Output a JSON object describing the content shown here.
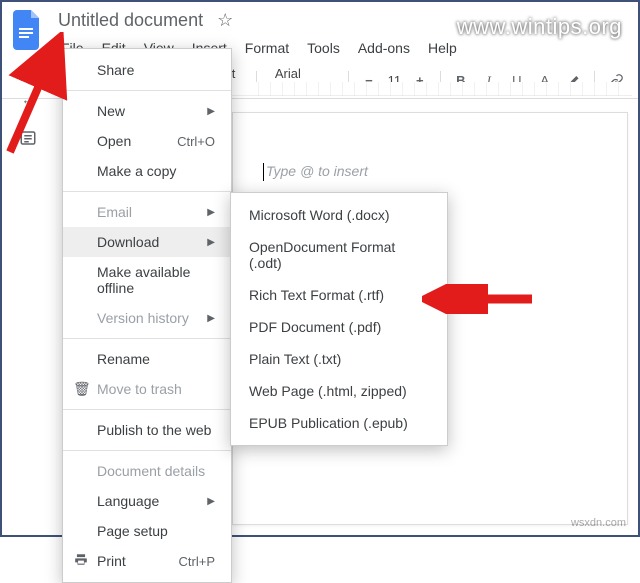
{
  "doc": {
    "title": "Untitled document"
  },
  "menubar": {
    "file": "File",
    "edit": "Edit",
    "view": "View",
    "insert": "Insert",
    "format": "Format",
    "tools": "Tools",
    "addons": "Add-ons",
    "help": "Help"
  },
  "toolbar": {
    "style_label": "ormal text",
    "font_label": "Arial",
    "font_size": "11"
  },
  "page": {
    "placeholder": "Type @ to insert"
  },
  "file_menu": {
    "share": "Share",
    "new": "New",
    "open": "Open",
    "open_shortcut": "Ctrl+O",
    "make_copy": "Make a copy",
    "email": "Email",
    "download": "Download",
    "make_offline": "Make available offline",
    "version_history": "Version history",
    "rename": "Rename",
    "move_to_trash": "Move to trash",
    "publish": "Publish to the web",
    "doc_details": "Document details",
    "language": "Language",
    "page_setup": "Page setup",
    "print": "Print",
    "print_shortcut": "Ctrl+P"
  },
  "download_menu": {
    "docx": "Microsoft Word (.docx)",
    "odt": "OpenDocument Format (.odt)",
    "rtf": "Rich Text Format (.rtf)",
    "pdf": "PDF Document (.pdf)",
    "txt": "Plain Text (.txt)",
    "html": "Web Page (.html, zipped)",
    "epub": "EPUB Publication (.epub)"
  },
  "watermark": {
    "top": "www.wintips.org",
    "bottom": "wsxdn.com"
  }
}
